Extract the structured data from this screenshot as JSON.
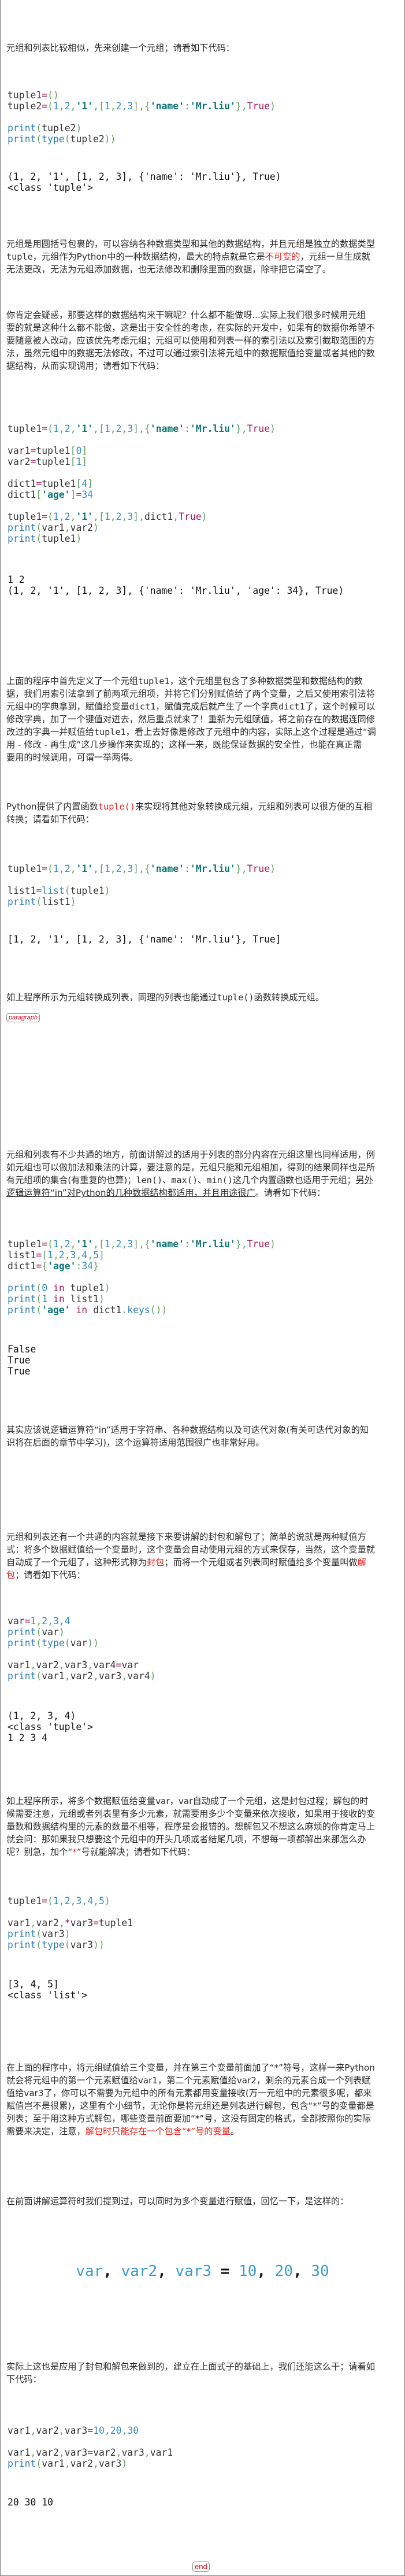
{
  "blocks": [
    {
      "kind": "text",
      "lines": [
        [
          "元组和列表比较相似，先来创建一个元组；请看如下代码："
        ]
      ]
    },
    {
      "kind": "code",
      "lines": [
        "tuple1=()",
        "tuple2=(1,2,'1',[1,2,3],{'name':'Mr.liu'},True)",
        "",
        "print(tuple2)",
        "print(type(tuple2))"
      ]
    },
    {
      "kind": "output",
      "lines": [
        "(1, 2, '1', [1, 2, 3], {'name': 'Mr.liu'}, True)",
        "<class 'tuple'>"
      ]
    },
    {
      "kind": "text",
      "lines": [
        [
          "元组是用圆括号包裹的，可以容纳各种数据类型和其他的数据结构，并且元组是独立的数据类型"
        ],
        [
          {
            "t": "tuple",
            "s": "mono"
          },
          "，元组作为Python中的一种数据结构，最大的特点就是它是",
          {
            "t": "不可变的",
            "s": "red"
          },
          "，元组一旦生成就"
        ],
        [
          "无法更改，无法为元组添加数据，也无法修改和删除里面的数据，除非把它清空了。"
        ]
      ]
    },
    {
      "kind": "text",
      "lines": [
        [
          "你肯定会疑惑，那要这样的数据结构来干嘛呢？什么都不能做呀...实际上我们很多时候用元组"
        ],
        [
          "要的就是这种什么都不能做，这是出于安全性的考虑，在实际的开发中，如果有的数据你希望不"
        ],
        [
          "要随意被人改动，应该优先考虑元组；元组可以使用和列表一样的索引法以及索引截取范围的方"
        ],
        [
          "法，虽然元组中的数据无法修改，不过可以通过索引法将元组中的数据赋值给变量或者其他的数"
        ],
        [
          "据结构，从而实现调用；请看如下代码："
        ]
      ]
    },
    {
      "kind": "code",
      "lines": [
        "tuple1=(1,2,'1',[1,2,3],{'name':'Mr.liu'},True)",
        "",
        "var1=tuple1[0]",
        "var2=tuple1[1]",
        "",
        "dict1=tuple1[4]",
        "dict1['age']=34",
        "",
        "tuple1=(1,2,'1',[1,2,3],dict1,True)",
        "print(var1,var2)",
        "print(tuple1)"
      ]
    },
    {
      "kind": "output",
      "lines": [
        "1 2",
        "(1, 2, '1', [1, 2, 3], {'name': 'Mr.liu', 'age': 34}, True)"
      ]
    },
    {
      "kind": "text",
      "lines": [
        [
          "上面的程序中首先定义了一个元组",
          {
            "t": "tuple1",
            "s": "mono"
          },
          "，这个元组里包含了多种数据类型和数据结构的数"
        ],
        [
          "据，我们用索引法拿到了前两项元组项，并将它们分别赋值给了两个变量，之后又使用索引法将"
        ],
        [
          "元组中的字典拿到，赋值给变量",
          {
            "t": "dict1",
            "s": "mono"
          },
          "，赋值完成后就产生了一个字典",
          {
            "t": "dict1",
            "s": "mono"
          },
          "了，这个时候可以"
        ],
        [
          "修改字典，加了一个键值对进去，然后重点就来了！重新为元组赋值，将之前存在的数据连同修"
        ],
        [
          "改过的字典一并赋值给",
          {
            "t": "tuple1",
            "s": "mono"
          },
          "，看上去好像是修改了元组中的内容，实际上这个过程是通过“调"
        ],
        [
          "用 - 修改 - 再生成”这几步操作来实现的；这样一来，既能保证数据的安全性，也能在真正需"
        ],
        [
          "要用的时候调用，可谓一举两得。"
        ]
      ]
    },
    {
      "kind": "text",
      "lines": [
        [
          "Python提供了内置函数",
          {
            "t": "tuple()",
            "s": "red mono"
          },
          "来实现将其他对象转换成元组，元组和列表可以很方便的互相"
        ],
        [
          "转换；请看如下代码："
        ]
      ]
    },
    {
      "kind": "code",
      "lines": [
        "tuple1=(1,2,'1',[1,2,3],{'name':'Mr.liu'},True)",
        "",
        "list1=list(tuple1)",
        "print(list1)"
      ]
    },
    {
      "kind": "output",
      "lines": [
        "[1, 2, '1', [1, 2, 3], {'name': 'Mr.liu'}, True]"
      ]
    },
    {
      "kind": "text",
      "lines": [
        [
          "如上程序所示为元组转换成列表，同理的列表也能通过",
          {
            "t": "tuple()",
            "s": "mono"
          },
          "函数转换成元组。"
        ]
      ]
    },
    {
      "kind": "tag",
      "text": "paragraph"
    },
    {
      "kind": "text",
      "lines": [
        [
          "元组和列表有不少共通的地方，前面讲解过的适用于列表的部分内容在元组这里也同样适用，例"
        ],
        [
          "如元组也可以做加法和乘法的计算，要注意的是，元组只能和元组相加，得到的结果同样也是所"
        ],
        [
          "有元组项的集合(有重复的也算)；",
          {
            "t": "len()、max()、min()",
            "s": "mono"
          },
          "这几个内置函数也适用于元组；",
          {
            "t": "另外",
            "s": "u"
          }
        ],
        [
          {
            "t": "逻辑运算符“in”对Python的几种数据结构都适用，并且用途很广",
            "s": "u"
          },
          "。请看如下代码："
        ]
      ]
    },
    {
      "kind": "code",
      "lines": [
        "tuple1=(1,2,'1',[1,2,3],{'name':'Mr.liu'},True)",
        "list1=[1,2,3,4,5]",
        "dict1={'age':34}",
        "",
        "print(0 in tuple1)",
        "print(1 in list1)",
        "print('age' in dict1.keys())"
      ]
    },
    {
      "kind": "output",
      "lines": [
        "False",
        "True",
        "True"
      ]
    },
    {
      "kind": "text",
      "lines": [
        [
          "其实应该说逻辑运算符“in”适用于字符串、各种数据结构以及可迭代对象(有关可迭代对象的知"
        ],
        [
          "识将在后面的章节中学习)，这个运算符适用范围很广也非常好用。"
        ]
      ]
    },
    {
      "kind": "text",
      "lines": [
        [
          "元组和列表还有一个共通的内容就是接下来要讲解的封包和解包了；简单的说就是两种赋值方"
        ],
        [
          "式：将多个数据赋值给一个变量时，这个变量会自动使用元组的方式来保存，当然，这个变量就"
        ],
        [
          "自动成了一个元组了，这种形式称为",
          {
            "t": "封包",
            "s": "red"
          },
          "；而将一个元组或者列表同时赋值给多个变量叫做",
          {
            "t": "解",
            "s": "red"
          }
        ],
        [
          {
            "t": "包",
            "s": "red"
          },
          "；请看如下代码："
        ]
      ]
    },
    {
      "kind": "code",
      "lines": [
        "var=1,2,3,4",
        "print(var)",
        "print(type(var))",
        "",
        "var1,var2,var3,var4=var",
        "print(var1,var2,var3,var4)"
      ]
    },
    {
      "kind": "output",
      "lines": [
        "(1, 2, 3, 4)",
        "<class 'tuple'>",
        "1 2 3 4"
      ]
    },
    {
      "kind": "text",
      "lines": [
        [
          "如上程序所示，将多个数据赋值给变量var，var自动成了一个元组，这是封包过程；解包的时"
        ],
        [
          "候需要注意，元组或者列表里有多少元素，就需要用多少个变量来依次接收，如果用于接收的变"
        ],
        [
          "量数和数据结构里的元素的数量不相等，程序是会报错的。想解包又不想这么麻烦的你肯定马上"
        ],
        [
          "就会问：那如果我只想要这个元组中的开头几项或者结尾几项，不想每一项都解出来那怎么办"
        ],
        [
          "呢？别急，加个“",
          {
            "t": "*",
            "s": "red"
          },
          "”号就能解决；请看如下代码："
        ]
      ]
    },
    {
      "kind": "code",
      "lines": [
        "tuple1=(1,2,3,4,5)",
        "",
        "var1,var2,*var3=tuple1",
        "print(var3)",
        "print(type(var3))"
      ]
    },
    {
      "kind": "output",
      "lines": [
        "[3, 4, 5]",
        "<class 'list'>"
      ]
    },
    {
      "kind": "text",
      "lines": [
        [
          "在上面的程序中，将元组赋值给三个变量，并在第三个变量前面加了“*”符号，这样一来Python"
        ],
        [
          "就会将元组中的第一个元素赋值给var1，第二个元素赋值给var2，剩余的元素合成一个列表赋"
        ],
        [
          "值给var3了，你可以不需要为元组中的所有元素都用变量接收(万一元组中的元素很多呢，都来"
        ],
        [
          "赋值岂不是很累)，这里有个小细节，无论你是将元组还是列表进行解包，包含“*”号的变量都是"
        ],
        [
          "列表；至于用这种方式解包，哪些变量前面要加“*”号，这没有固定的格式，全部按照你的实际"
        ],
        [
          "需要来决定，注意，",
          {
            "t": "解包时只能存在一个包含“*”号的变量",
            "s": "red"
          },
          "。"
        ]
      ]
    },
    {
      "kind": "text",
      "lines": [
        [
          "在前面讲解运算符时我们提到过，可以同时为多个变量进行赋值，回忆一下，是这样的："
        ]
      ]
    },
    {
      "kind": "formula",
      "text": "var, var2, var3 = 10, 20, 30"
    },
    {
      "kind": "text",
      "lines": [
        [
          "实际上这也是应用了封包和解包来做到的，建立在上面式子的基础上，我们还能这么干；请看如"
        ],
        [
          "下代码："
        ]
      ]
    },
    {
      "kind": "code",
      "lines": [
        "var1,var2,var3=10,20,30",
        "",
        "var1,var2,var3=var2,var3,var1",
        "print(var1,var2,var3)"
      ]
    },
    {
      "kind": "output",
      "lines": [
        "20 30 10"
      ]
    },
    {
      "kind": "tag",
      "text": "end"
    }
  ],
  "colors": {
    "highlight": "#e0201c",
    "keyword": "#2f7fb3",
    "operator": "#a3195b",
    "number": "#2f8bc0",
    "string": "#0f7474",
    "bracket": "#5f9d62"
  }
}
